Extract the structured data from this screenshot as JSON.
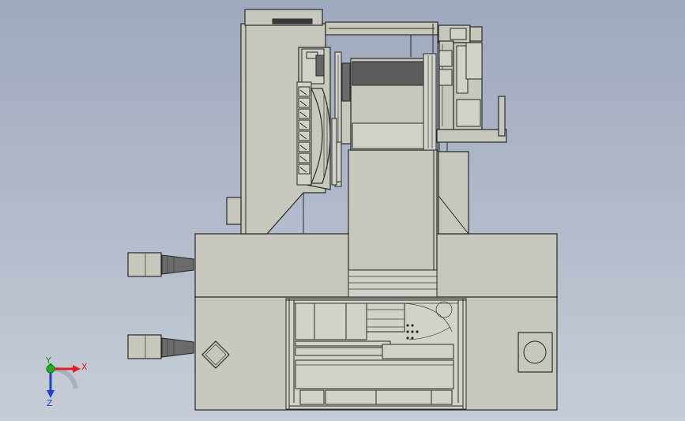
{
  "view": {
    "background_top": "#9fa9bd",
    "background_bottom": "#c6cdd8",
    "part_fill": "#c7c7bc",
    "edge_color": "#2a2a2a",
    "dark_fill": "#5c5c5c"
  },
  "triad": {
    "x_label": "X",
    "y_label": "Y",
    "z_label": "Z",
    "x_color": "#e02020",
    "y_color": "#1e8a1e",
    "z_color": "#2040d0"
  }
}
